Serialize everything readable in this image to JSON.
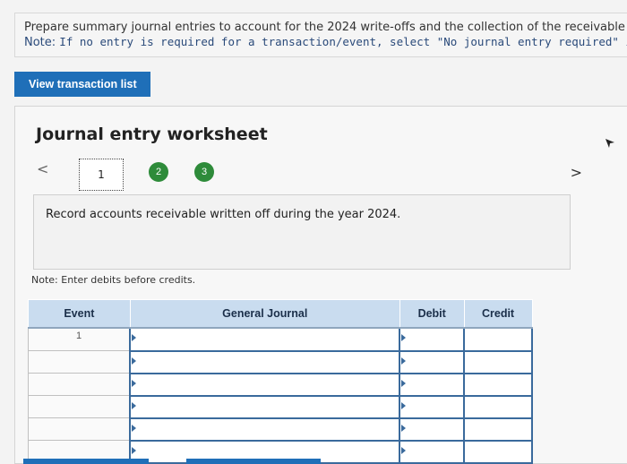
{
  "instructions": {
    "line1": "Prepare summary journal entries to account for the 2024 write-offs and the collection of the receivable",
    "line2_prefix": "Note: ",
    "line2_text": "If no entry is required for a transaction/event, select \"No journal entry required\" in the first accou"
  },
  "view_button": "View transaction list",
  "worksheet": {
    "title": "Journal entry worksheet",
    "steps": [
      "1",
      "2",
      "3"
    ],
    "description": "Record accounts receivable written off during the year 2024.",
    "note": "Note: Enter debits before credits."
  },
  "table": {
    "headers": {
      "event": "Event",
      "journal": "General Journal",
      "debit": "Debit",
      "credit": "Credit"
    },
    "rows": [
      {
        "event": "1"
      },
      {
        "event": ""
      },
      {
        "event": ""
      },
      {
        "event": ""
      },
      {
        "event": ""
      },
      {
        "event": ""
      }
    ]
  },
  "colors": {
    "accent": "#1f6fb8",
    "step_done": "#2e8b3a",
    "header_bg": "#c9dcef"
  }
}
